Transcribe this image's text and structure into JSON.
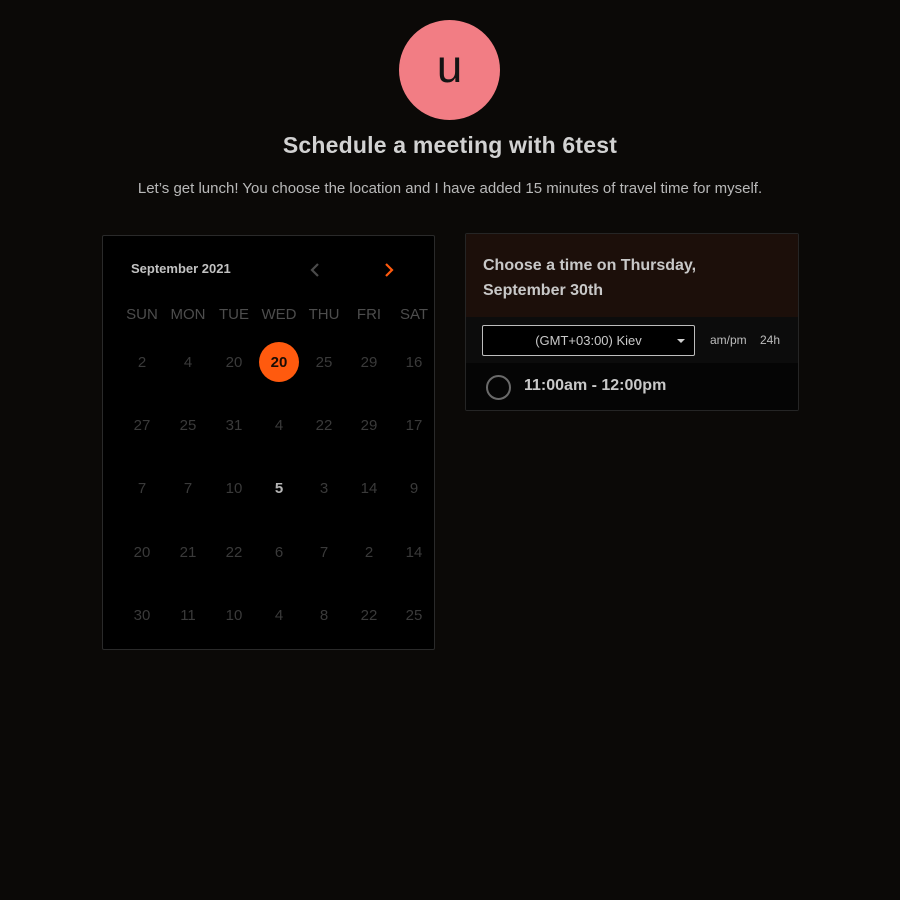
{
  "host": {
    "avatar_letter": "u",
    "avatar_color": "#f27d84"
  },
  "heading": {
    "title": "Schedule a meeting with 6test",
    "subtitle": "Let’s get lunch! You choose the location and I have added 15 minutes of travel time for myself."
  },
  "calendar": {
    "month_label": "September 2021",
    "prev_icon": "chevron-left-icon",
    "next_icon": "chevron-right-icon",
    "accent_color": "#ff5a0e",
    "weekdays": [
      "SUN",
      "MON",
      "TUE",
      "WED",
      "THU",
      "FRI",
      "SAT"
    ],
    "weeks": [
      [
        "2",
        "4",
        "20",
        "20",
        "25",
        "29",
        "16"
      ],
      [
        "27",
        "25",
        "31",
        "4",
        "22",
        "29",
        "17"
      ],
      [
        "7",
        "7",
        "10",
        "5",
        "3",
        "14",
        "9"
      ],
      [
        "20",
        "21",
        "22",
        "6",
        "7",
        "2",
        "14"
      ],
      [
        "30",
        "11",
        "10",
        "4",
        "8",
        "22",
        "25"
      ]
    ],
    "selected_day": "20",
    "available_day": "5"
  },
  "time_panel": {
    "header": "Choose a time on Thursday, September 30th",
    "timezone": "(GMT+03:00) Kiev",
    "format_ampm": "am/pm",
    "format_24h": "24h",
    "slots": [
      "11:00am - 12:00pm"
    ]
  }
}
